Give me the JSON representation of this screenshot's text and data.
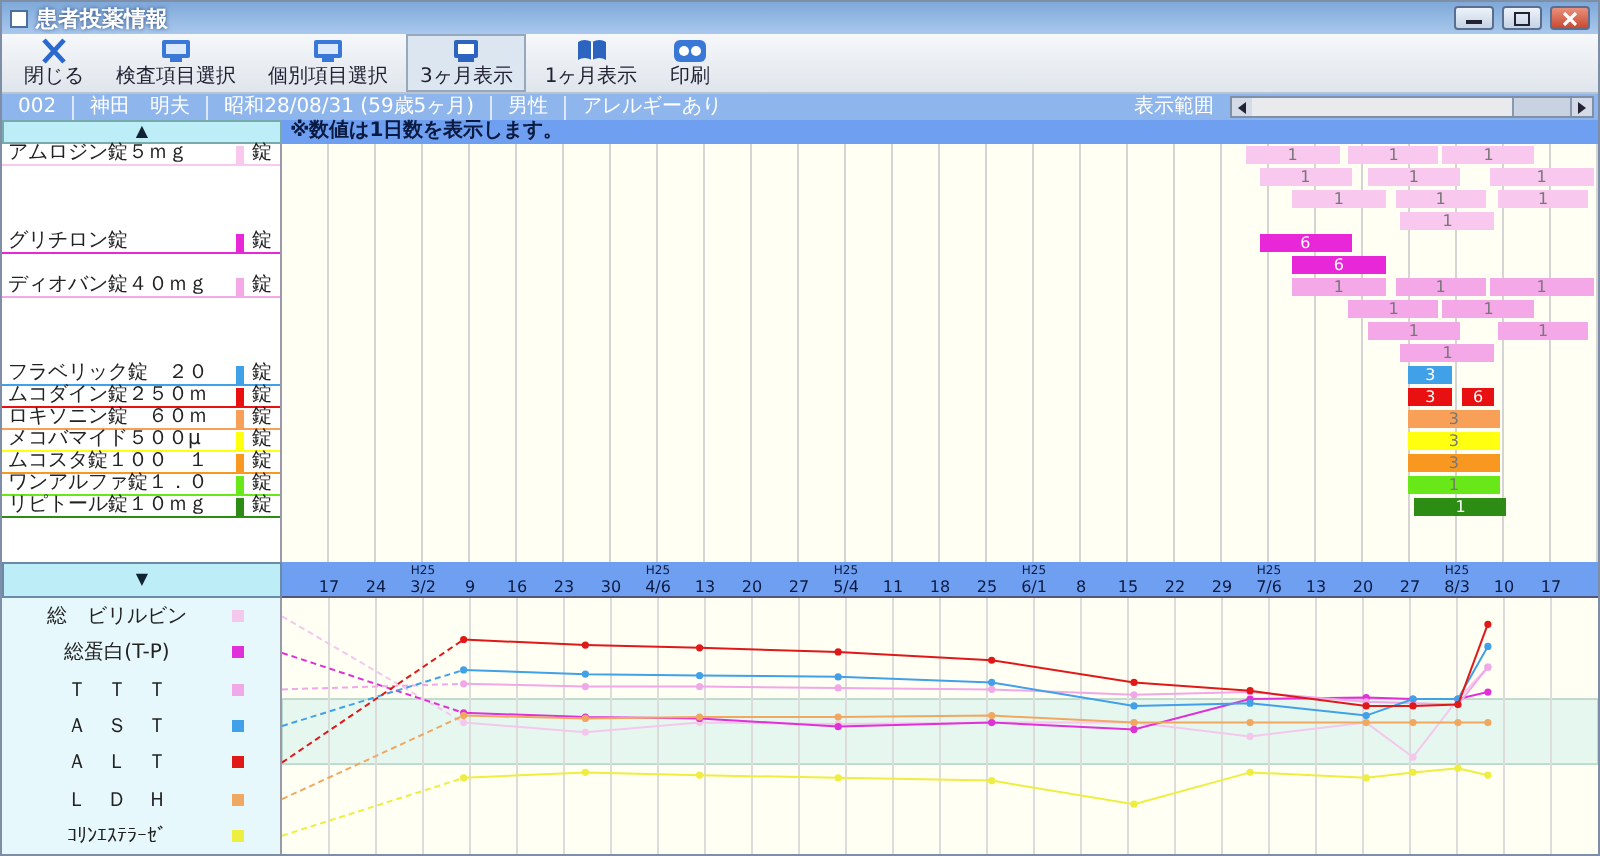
{
  "window": {
    "title": "患者投薬情報"
  },
  "toolbar": [
    {
      "kind": "close",
      "label": "閉じる",
      "selected": false
    },
    {
      "kind": "monitor",
      "label": "検査項目選択",
      "selected": false
    },
    {
      "kind": "monitor",
      "label": "個別項目選択",
      "selected": false
    },
    {
      "kind": "screen",
      "label": "3ヶ月表示",
      "selected": true
    },
    {
      "kind": "book",
      "label": "1ヶ月表示",
      "selected": false
    },
    {
      "kind": "glasses",
      "label": "印刷",
      "selected": false
    }
  ],
  "patient": {
    "fields": [
      "002",
      "神田　明夫",
      "昭和28/08/31 (59歳5ヶ月)",
      "男性",
      "アレルギーあり"
    ],
    "range_label": "表示範囲"
  },
  "drug_panel": {
    "scroll_up": "▲",
    "note": "※数値は1日数を表示します。",
    "scroll_down": "▼"
  },
  "drugs": [
    {
      "name": "アムロジン錠５ｍｇ",
      "unit": "錠",
      "color": "#f8c8ee",
      "rows": [
        {
          "doses": [
            {
              "label": "1"
            },
            {
              "label": "1"
            },
            {
              "label": "1"
            }
          ]
        },
        {
          "doses": [
            {
              "label": "1"
            },
            {
              "label": "1"
            },
            {
              "label": "1"
            }
          ]
        },
        {
          "doses": [
            {
              "label": "1"
            },
            {
              "label": "1"
            },
            {
              "label": "1"
            }
          ]
        },
        {
          "doses": [
            {
              "label": "1"
            }
          ]
        }
      ]
    },
    {
      "name": "グリチロン錠",
      "unit": "錠",
      "color": "#e828d8",
      "rows": [
        {
          "doses": [
            {
              "label": "6"
            }
          ]
        },
        {
          "doses": [
            {
              "label": "6"
            }
          ]
        }
      ]
    },
    {
      "name": "ディオバン錠４０ｍｇ",
      "unit": "錠",
      "color": "#f4a8e8",
      "rows": [
        {
          "doses": [
            {
              "label": "1"
            },
            {
              "label": "1"
            },
            {
              "label": "1"
            }
          ]
        },
        {
          "doses": [
            {
              "label": "1"
            },
            {
              "label": "1"
            }
          ]
        },
        {
          "doses": [
            {
              "label": "1"
            },
            {
              "label": "1"
            }
          ]
        },
        {
          "doses": [
            {
              "label": "1"
            }
          ]
        }
      ]
    },
    {
      "name": "フラベリック錠　２０",
      "unit": "錠",
      "color": "#40a0e8",
      "rows": [
        {
          "doses": [
            {
              "label": "3"
            }
          ]
        }
      ]
    },
    {
      "name": "ムコダイン錠２５０ｍ",
      "unit": "錠",
      "color": "#e81010",
      "rows": [
        {
          "doses": [
            {
              "label": "3"
            },
            {
              "label": "6"
            }
          ]
        }
      ]
    },
    {
      "name": "ロキソニン錠　６０ｍ",
      "unit": "錠",
      "color": "#f8a058",
      "rows": [
        {
          "doses": [
            {
              "label": "3"
            }
          ]
        }
      ]
    },
    {
      "name": "メコバマイド５００μ",
      "unit": "錠",
      "color": "#ffff10",
      "rows": [
        {
          "doses": [
            {
              "label": "3"
            }
          ]
        }
      ]
    },
    {
      "name": "ムコスタ錠１００　１",
      "unit": "錠",
      "color": "#f89820",
      "rows": [
        {
          "doses": [
            {
              "label": "3"
            }
          ]
        }
      ]
    },
    {
      "name": "ワンアルファ錠１．０",
      "unit": "錠",
      "color": "#68e818",
      "rows": [
        {
          "doses": [
            {
              "label": "1"
            }
          ]
        }
      ]
    },
    {
      "name": "リピトール錠１０ｍｇ",
      "unit": "錠",
      "color": "#2c8c14",
      "rows": [
        {
          "doses": [
            {
              "label": "1"
            }
          ]
        }
      ]
    }
  ],
  "timeline": {
    "dates": [
      {
        "date": "17"
      },
      {
        "date": "24"
      },
      {
        "era": "H25",
        "date": "3/2"
      },
      {
        "date": "9"
      },
      {
        "date": "16"
      },
      {
        "date": "23"
      },
      {
        "date": "30"
      },
      {
        "era": "H25",
        "date": "4/6"
      },
      {
        "date": "13"
      },
      {
        "date": "20"
      },
      {
        "date": "27"
      },
      {
        "era": "H25",
        "date": "5/4"
      },
      {
        "date": "11"
      },
      {
        "date": "18"
      },
      {
        "date": "25"
      },
      {
        "era": "H25",
        "date": "6/1"
      },
      {
        "date": "8"
      },
      {
        "date": "15"
      },
      {
        "date": "22"
      },
      {
        "date": "29"
      },
      {
        "era": "H25",
        "date": "7/6"
      },
      {
        "date": "13"
      },
      {
        "date": "20"
      },
      {
        "date": "27"
      },
      {
        "era": "H25",
        "date": "8/3"
      },
      {
        "date": "10"
      },
      {
        "date": "17"
      }
    ]
  },
  "labs": [
    {
      "name": "総　ビリルビン",
      "color": "#f4c8ec"
    },
    {
      "name": "総蛋白(T-P)",
      "color": "#e030d8"
    },
    {
      "name": "Ｔ　Ｔ　Ｔ",
      "color": "#f0a8e8"
    },
    {
      "name": "Ａ　Ｓ　Ｔ",
      "color": "#40a0e8"
    },
    {
      "name": "Ａ　Ｌ　Ｔ",
      "color": "#e01818"
    },
    {
      "name": "Ｌ　Ｄ　Ｈ",
      "color": "#f0a860"
    },
    {
      "name": "ｺﾘﾝｴｽﾃﾗｰｾﾞ",
      "color": "#eeee40"
    }
  ]
}
